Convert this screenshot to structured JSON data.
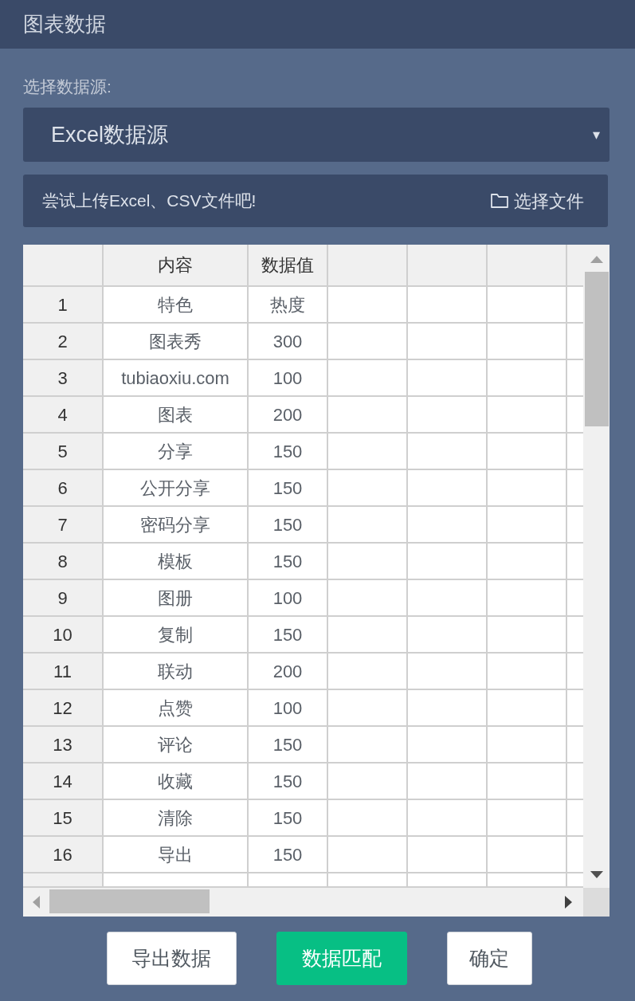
{
  "panel": {
    "title": "图表数据"
  },
  "source": {
    "label": "选择数据源:",
    "value": "Excel数据源",
    "caret": "▾"
  },
  "upload": {
    "placeholder": "尝试上传Excel、CSV文件吧!",
    "button": "选择文件"
  },
  "table": {
    "columns": [
      "内容",
      "数据值"
    ],
    "rows": [
      {
        "index": "1",
        "cells": [
          "特色",
          "热度"
        ]
      },
      {
        "index": "2",
        "cells": [
          "图表秀",
          "300"
        ]
      },
      {
        "index": "3",
        "cells": [
          "tubiaoxiu.com",
          "100"
        ]
      },
      {
        "index": "4",
        "cells": [
          "图表",
          "200"
        ]
      },
      {
        "index": "5",
        "cells": [
          "分享",
          "150"
        ]
      },
      {
        "index": "6",
        "cells": [
          "公开分享",
          "150"
        ]
      },
      {
        "index": "7",
        "cells": [
          "密码分享",
          "150"
        ]
      },
      {
        "index": "8",
        "cells": [
          "模板",
          "150"
        ]
      },
      {
        "index": "9",
        "cells": [
          "图册",
          "100"
        ]
      },
      {
        "index": "10",
        "cells": [
          "复制",
          "150"
        ]
      },
      {
        "index": "11",
        "cells": [
          "联动",
          "200"
        ]
      },
      {
        "index": "12",
        "cells": [
          "点赞",
          "100"
        ]
      },
      {
        "index": "13",
        "cells": [
          "评论",
          "150"
        ]
      },
      {
        "index": "14",
        "cells": [
          "收藏",
          "150"
        ]
      },
      {
        "index": "15",
        "cells": [
          "清除",
          "150"
        ]
      },
      {
        "index": "16",
        "cells": [
          "导出",
          "150"
        ]
      }
    ]
  },
  "buttons": [
    {
      "label": "导出数据",
      "kind": "default"
    },
    {
      "label": "数据匹配",
      "kind": "primary"
    },
    {
      "label": "确定",
      "kind": "default"
    }
  ]
}
